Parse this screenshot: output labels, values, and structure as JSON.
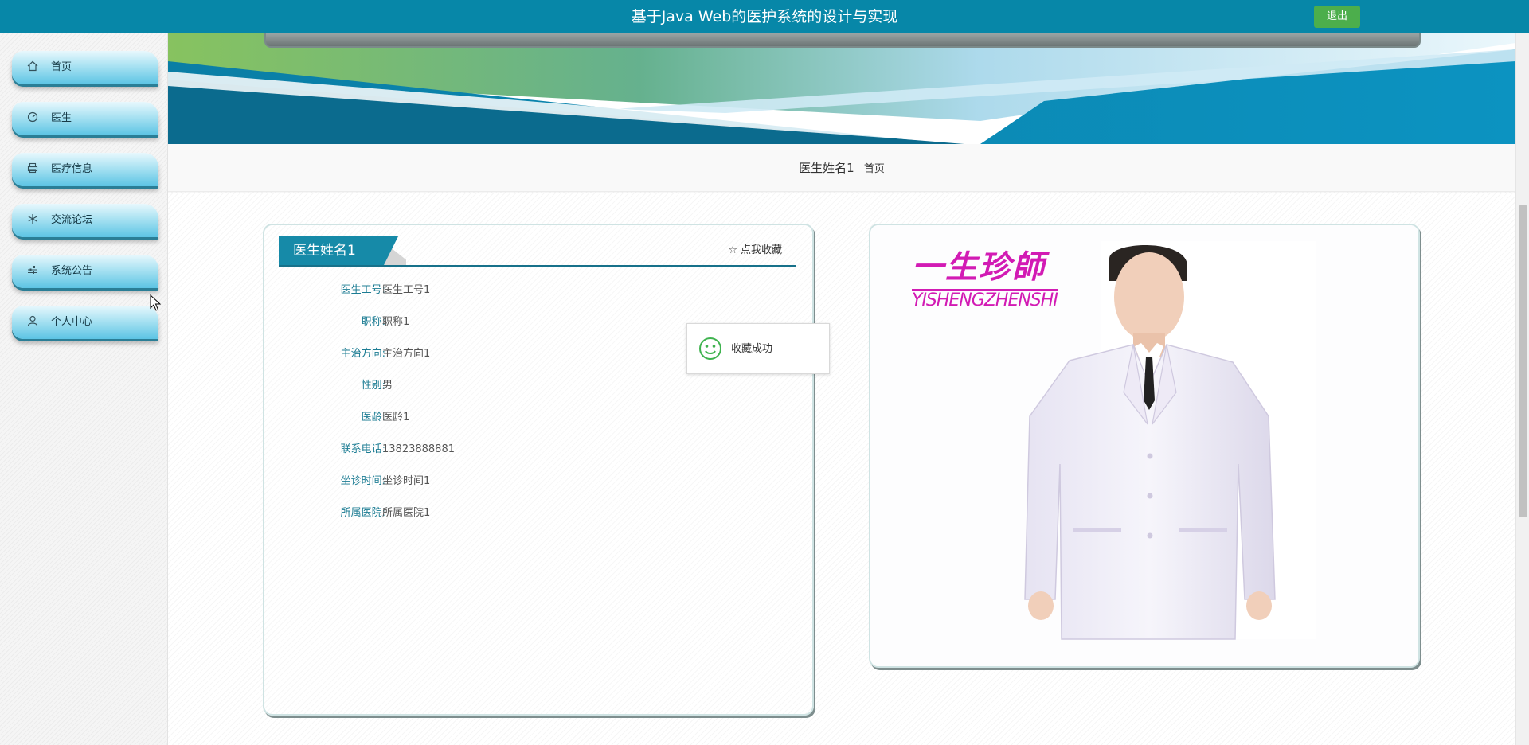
{
  "header": {
    "title": "基于Java Web的医护系统的设计与实现",
    "logout_label": "退出",
    "color": "#0787a8"
  },
  "sidebar": {
    "items": [
      {
        "label": "首页",
        "icon": "home-icon"
      },
      {
        "label": "医生",
        "icon": "gauge-icon"
      },
      {
        "label": "医疗信息",
        "icon": "printer-icon"
      },
      {
        "label": "交流论坛",
        "icon": "snowflake-icon"
      },
      {
        "label": "系统公告",
        "icon": "sliders-icon"
      },
      {
        "label": "个人中心",
        "icon": "user-icon"
      }
    ]
  },
  "breadcrumb": {
    "current": "医生姓名1",
    "home": "首页"
  },
  "detail": {
    "title": "医生姓名1",
    "favorite_label": "点我收藏",
    "fields": [
      {
        "label": "医生工号:",
        "value": "医生工号1"
      },
      {
        "label": "职称:",
        "value": "职称1"
      },
      {
        "label": "主治方向:",
        "value": "主治方向1"
      },
      {
        "label": "性别:",
        "value": "男"
      },
      {
        "label": "医龄:",
        "value": "医龄1"
      },
      {
        "label": "联系电话:",
        "value": "13823888881"
      },
      {
        "label": "坐诊时间:",
        "value": "坐诊时间1"
      },
      {
        "label": "所属医院:",
        "value": "所属医院1"
      }
    ]
  },
  "image": {
    "logo_cn": "一生珍師",
    "logo_en": "YISHENGZHENSHI"
  },
  "toast": {
    "message": "收藏成功"
  }
}
